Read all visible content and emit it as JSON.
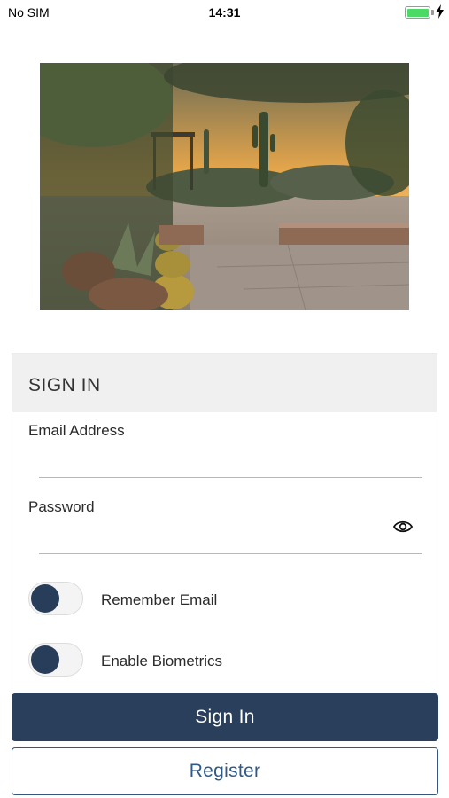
{
  "status_bar": {
    "carrier": "No SIM",
    "time": "14:31",
    "battery_level": 1.0,
    "charging": true
  },
  "hero_image": {
    "description_icon": "desert-garden-photo"
  },
  "sign_in_card": {
    "title": "SIGN IN",
    "email_label": "Email Address",
    "email_value": "",
    "password_label": "Password",
    "password_value": "",
    "remember_email_label": "Remember Email",
    "remember_email_on": false,
    "biometrics_label": "Enable Biometrics",
    "biometrics_on": false
  },
  "buttons": {
    "sign_in_label": "Sign In",
    "register_label": "Register"
  },
  "colors": {
    "primary": "#293f5b",
    "register_text": "#2f5a87",
    "battery": "#4cd964"
  }
}
